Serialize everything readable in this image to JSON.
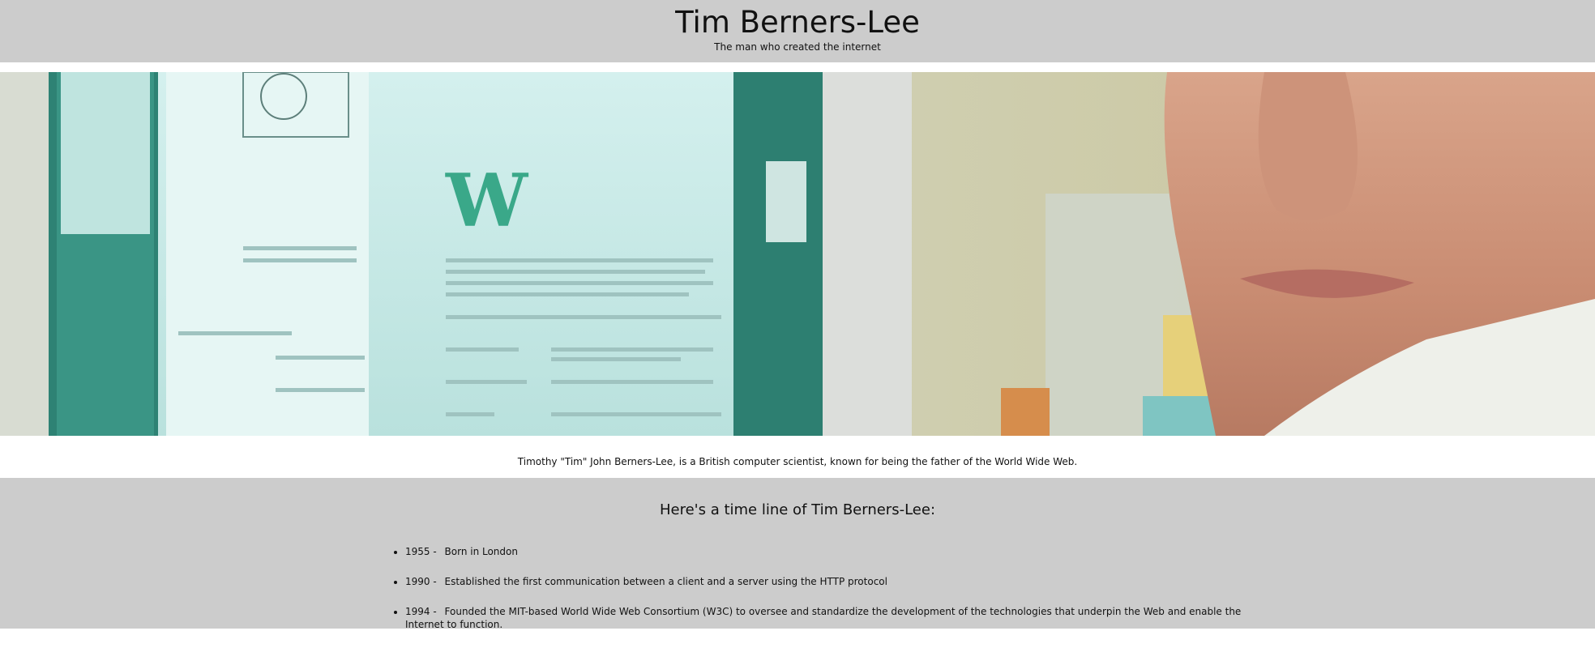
{
  "header": {
    "title": "Tim Berners-Lee",
    "subtitle": "The man who created the internet"
  },
  "hero_image": {
    "alt": "Tim Berners-Lee in front of a computer screen showing the early web"
  },
  "caption": "Timothy \"Tim\" John Berners-Lee, is a British computer scientist, known for being the father of the World Wide Web.",
  "timeline": {
    "heading": "Here's a time line of Tim Berners-Lee:",
    "items": [
      {
        "year": "1955 -",
        "text": "Born in London"
      },
      {
        "year": "1990 -",
        "text": "Established the first communication between a client and a server using the HTTP protocol"
      },
      {
        "year": "1994 -",
        "text": "Founded the MIT-based World Wide Web Consortium (W3C) to oversee and standardize the development of the technologies that underpin the Web and enable the Internet to function."
      }
    ]
  },
  "colors": {
    "header_bg": "#cccccc",
    "timeline_bg": "#cccccc",
    "page_bg": "#ffffff",
    "screen_teal": "#2f8a7d"
  }
}
